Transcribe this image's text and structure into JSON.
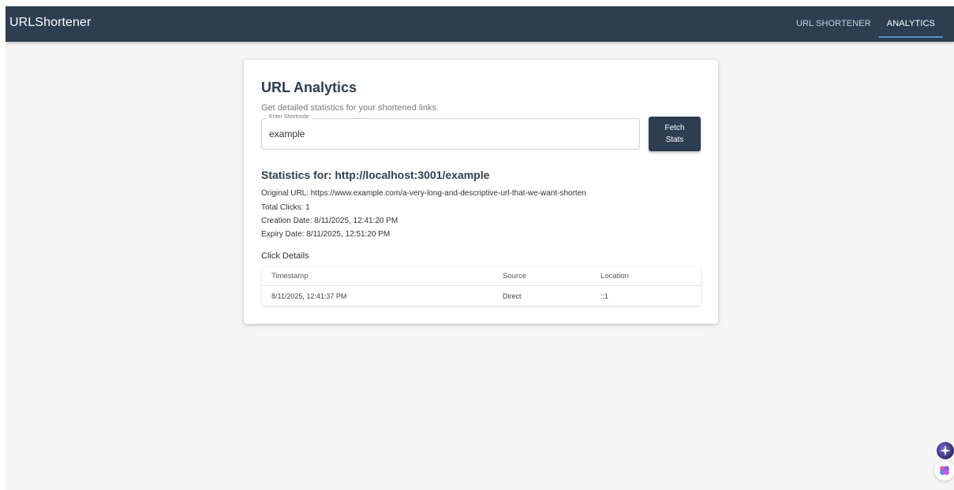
{
  "app": {
    "brand": "URLShortener",
    "nav": [
      {
        "label": "URL SHORTENER",
        "active": false
      },
      {
        "label": "ANALYTICS",
        "active": true
      }
    ]
  },
  "analytics": {
    "title": "URL Analytics",
    "subtitle": "Get detailed statistics for your shortened links.",
    "shortcode_field": {
      "label": "Enter Shortcode",
      "value": "example"
    },
    "fetch_button_label": "Fetch Stats"
  },
  "stats": {
    "heading": "Statistics for: http://localhost:3001/example",
    "original_url": "Original URL: https://www.example.com/a-very-long-and-descriptive-url-that-we-want-shorten",
    "total_clicks": "Total Clicks: 1",
    "creation_date": "Creation Date: 8/11/2025, 12:41:20 PM",
    "expiry_date": "Expiry Date: 8/11/2025, 12:51:20 PM",
    "click_details_label": "Click Details",
    "table": {
      "headers": [
        "Timestamp",
        "Source",
        "Location"
      ],
      "rows": [
        [
          "8/11/2025, 12:41:37 PM",
          "Direct",
          "::1"
        ]
      ]
    }
  },
  "widgets": {
    "top_icon": "sparkle-icon",
    "bottom_icon": "brain-icon",
    "colors": {
      "appbar": "#2c3e50",
      "accent": "#5b8ec9"
    }
  }
}
